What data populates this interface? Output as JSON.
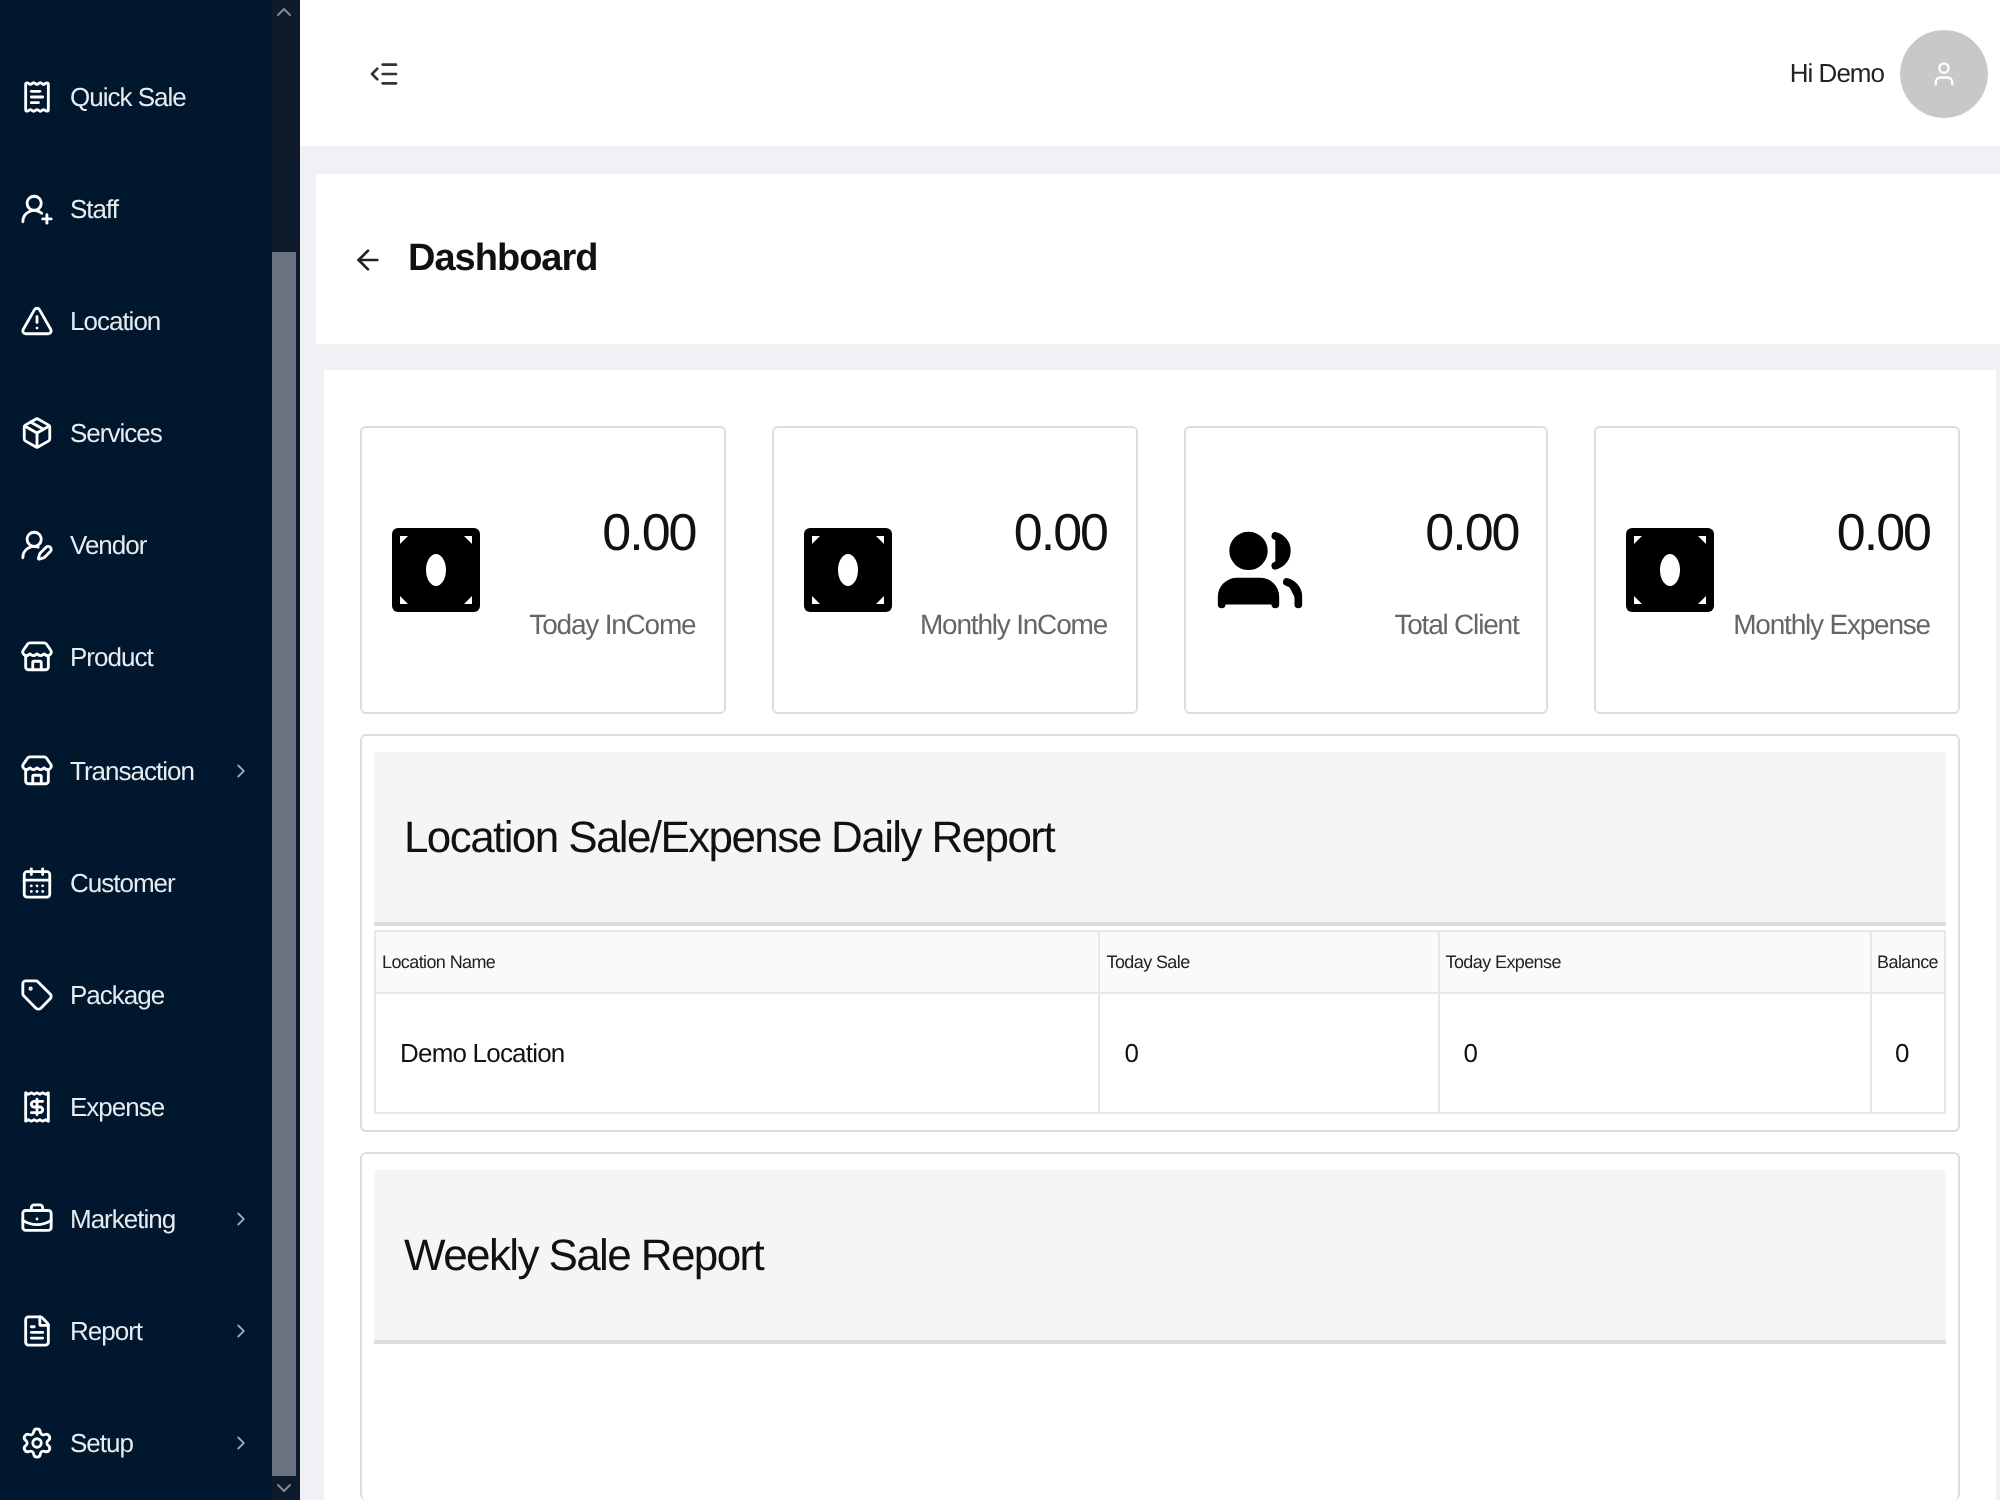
{
  "sidebar": {
    "items": [
      {
        "label": "Quick Sale",
        "has_submenu": false
      },
      {
        "label": "Staff",
        "has_submenu": false
      },
      {
        "label": "Location",
        "has_submenu": false
      },
      {
        "label": "Services",
        "has_submenu": false
      },
      {
        "label": "Vendor",
        "has_submenu": false
      },
      {
        "label": "Product",
        "has_submenu": false
      },
      {
        "label": "Transaction",
        "has_submenu": true
      },
      {
        "label": "Customer",
        "has_submenu": false
      },
      {
        "label": "Package",
        "has_submenu": false
      },
      {
        "label": "Expense",
        "has_submenu": false
      },
      {
        "label": "Marketing",
        "has_submenu": true
      },
      {
        "label": "Report",
        "has_submenu": true
      },
      {
        "label": "Setup",
        "has_submenu": true
      }
    ]
  },
  "header": {
    "greeting": "Hi Demo"
  },
  "page": {
    "title": "Dashboard"
  },
  "stats": [
    {
      "value": "0.00",
      "label": "Today InCome"
    },
    {
      "value": "0.00",
      "label": "Monthly InCome"
    },
    {
      "value": "0.00",
      "label": "Total Client"
    },
    {
      "value": "0.00",
      "label": "Monthly Expense"
    }
  ],
  "daily_report": {
    "title": "Location Sale/Expense Daily Report",
    "columns": [
      "Location Name",
      "Today Sale",
      "Today Expense",
      "Balance"
    ],
    "rows": [
      [
        "Demo Location",
        "0",
        "0",
        "0"
      ]
    ]
  },
  "weekly_report": {
    "title": "Weekly Sale Report"
  }
}
